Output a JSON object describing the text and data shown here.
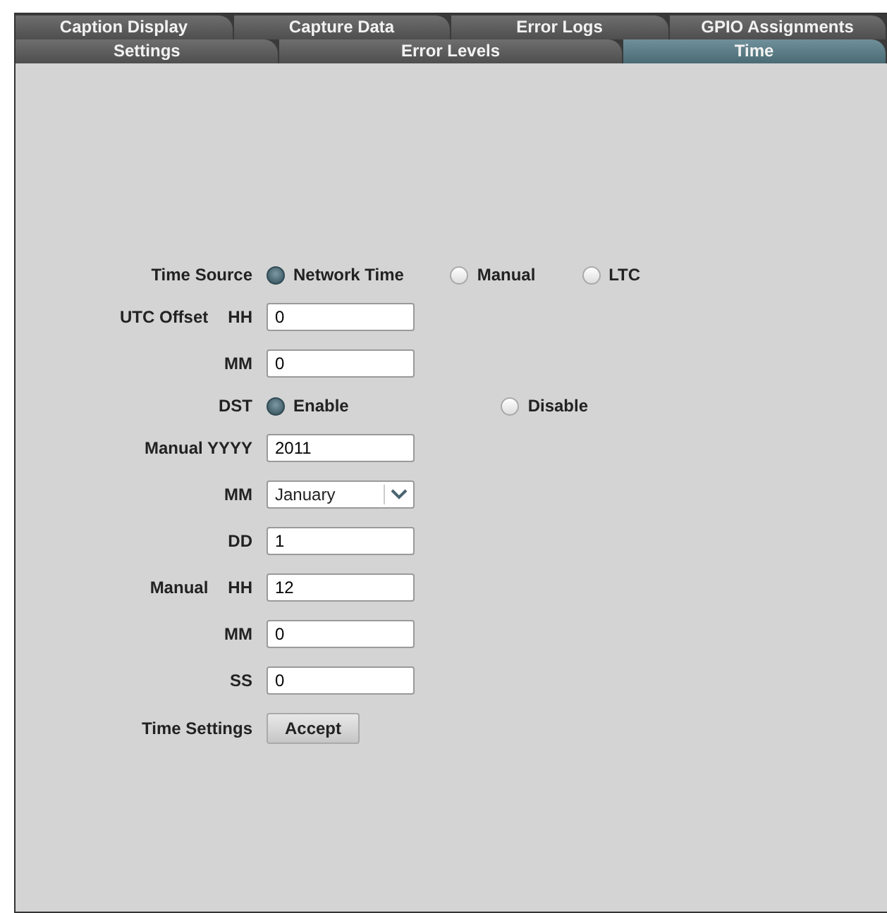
{
  "back_tabs": [
    {
      "label": "Caption Display",
      "selected": false
    },
    {
      "label": "Capture Data",
      "selected": false
    },
    {
      "label": "Error Logs",
      "selected": false
    },
    {
      "label": "GPIO Assignments",
      "selected": false
    }
  ],
  "front_tabs": [
    {
      "label": "Settings",
      "selected": false
    },
    {
      "label": "Error Levels",
      "selected": false
    },
    {
      "label": "Time",
      "selected": true
    }
  ],
  "form": [
    {
      "kind": "radio",
      "label": "Time Source",
      "options": [
        {
          "label": "Network Time",
          "selected": true
        },
        {
          "label": "Manual",
          "selected": false
        },
        {
          "label": "LTC",
          "selected": false
        }
      ]
    },
    {
      "kind": "text",
      "group": "UTC Offset",
      "label": "HH",
      "value": "0"
    },
    {
      "kind": "text",
      "label": "MM",
      "value": "0"
    },
    {
      "kind": "radio",
      "label": "DST",
      "options": [
        {
          "label": "Enable",
          "selected": true
        },
        {
          "label": "Disable",
          "selected": false
        }
      ]
    },
    {
      "kind": "text",
      "label": "Manual YYYY",
      "value": "2011"
    },
    {
      "kind": "select",
      "label": "MM",
      "value": "January"
    },
    {
      "kind": "text",
      "label": "DD",
      "value": "1"
    },
    {
      "kind": "text",
      "group": "Manual",
      "label": "HH",
      "value": "12"
    },
    {
      "kind": "text",
      "label": "MM",
      "value": "0"
    },
    {
      "kind": "text",
      "label": "SS",
      "value": "0"
    },
    {
      "kind": "button",
      "label": "Time Settings",
      "value": "Accept"
    }
  ]
}
